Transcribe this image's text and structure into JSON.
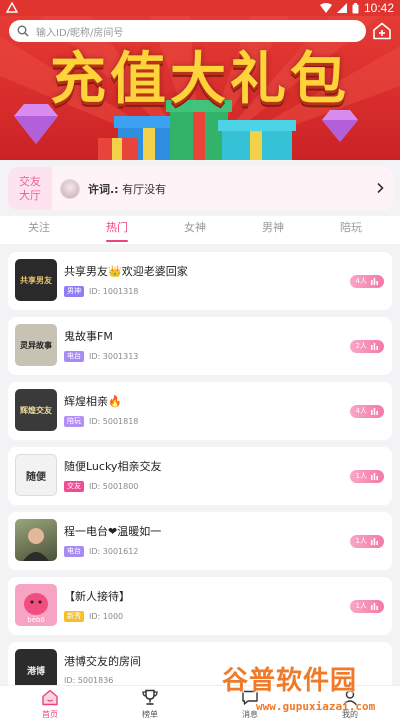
{
  "status_bar": {
    "time": "10:42"
  },
  "search": {
    "placeholder": "输入ID/昵称/房间号"
  },
  "banner": {
    "title": "充值大礼包"
  },
  "hall": {
    "tag": "交友大厅",
    "user": "许词.:",
    "message": "有厅没有"
  },
  "tabs": [
    {
      "label": "关注"
    },
    {
      "label": "热门",
      "active": true
    },
    {
      "label": "女神"
    },
    {
      "label": "男神"
    },
    {
      "label": "陪玩"
    }
  ],
  "rooms": [
    {
      "name": "共享男友👑欢迎老婆回家",
      "badge": "男神",
      "badge_color": "#8f7df3",
      "id": "ID: 1001318",
      "count": "4人",
      "thumb_text": "共享男友",
      "thumb_bg": "#2a2a2a",
      "thumb_fg": "#e8c56a"
    },
    {
      "name": "鬼故事FM",
      "badge": "电台",
      "badge_color": "#a78bf2",
      "id": "ID: 3001313",
      "count": "2人",
      "thumb_text": "灵异故事",
      "thumb_bg": "#c8c2b4",
      "thumb_fg": "#222"
    },
    {
      "name": "辉煌相亲🔥",
      "badge": "陪玩",
      "badge_color": "#b48ef7",
      "id": "ID: 5001818",
      "count": "4人",
      "thumb_text": "辉煌交友",
      "thumb_bg": "#3a3a3a",
      "thumb_fg": "#f0d9a0"
    },
    {
      "name": "随便Lucky相亲交友",
      "badge": "交友",
      "badge_color": "#f04a93",
      "id": "ID: 5001800",
      "count": "1人",
      "thumb_text": "随便",
      "thumb_bg": "#f2f2f2",
      "thumb_fg": "#333"
    },
    {
      "name": "程一电台❤温暖如一",
      "badge": "电台",
      "badge_color": "#a78bf2",
      "id": "ID: 3001612",
      "count": "1人",
      "thumb_text": "",
      "thumb_bg": "#6b7a5a",
      "thumb_fg": "#fff"
    },
    {
      "name": "【新人接待】",
      "badge": "新秀",
      "badge_color": "#f5c02b",
      "id": "ID: 1000",
      "count": "1人",
      "thumb_text": "bēbō",
      "thumb_bg": "#f58fb7",
      "thumb_fg": "#fff"
    },
    {
      "name": "港博交友的房间",
      "badge": "",
      "badge_color": "#a78bf2",
      "id": "ID: 5001836",
      "count": "",
      "thumb_text": "港博",
      "thumb_bg": "#2c2c2c",
      "thumb_fg": "#eee"
    }
  ],
  "bottom_nav": [
    {
      "label": "首页",
      "icon": "home-icon",
      "active": true
    },
    {
      "label": "榜单",
      "icon": "trophy-icon"
    },
    {
      "label": "消息",
      "icon": "message-icon"
    },
    {
      "label": "我的",
      "icon": "person-icon"
    }
  ],
  "watermark": {
    "title": "谷普软件园",
    "url": "www.gupuxiazai.com"
  },
  "colors": {
    "accent": "#e9457c",
    "banner_red": "#e0342f",
    "gold": "#ffd43a"
  }
}
